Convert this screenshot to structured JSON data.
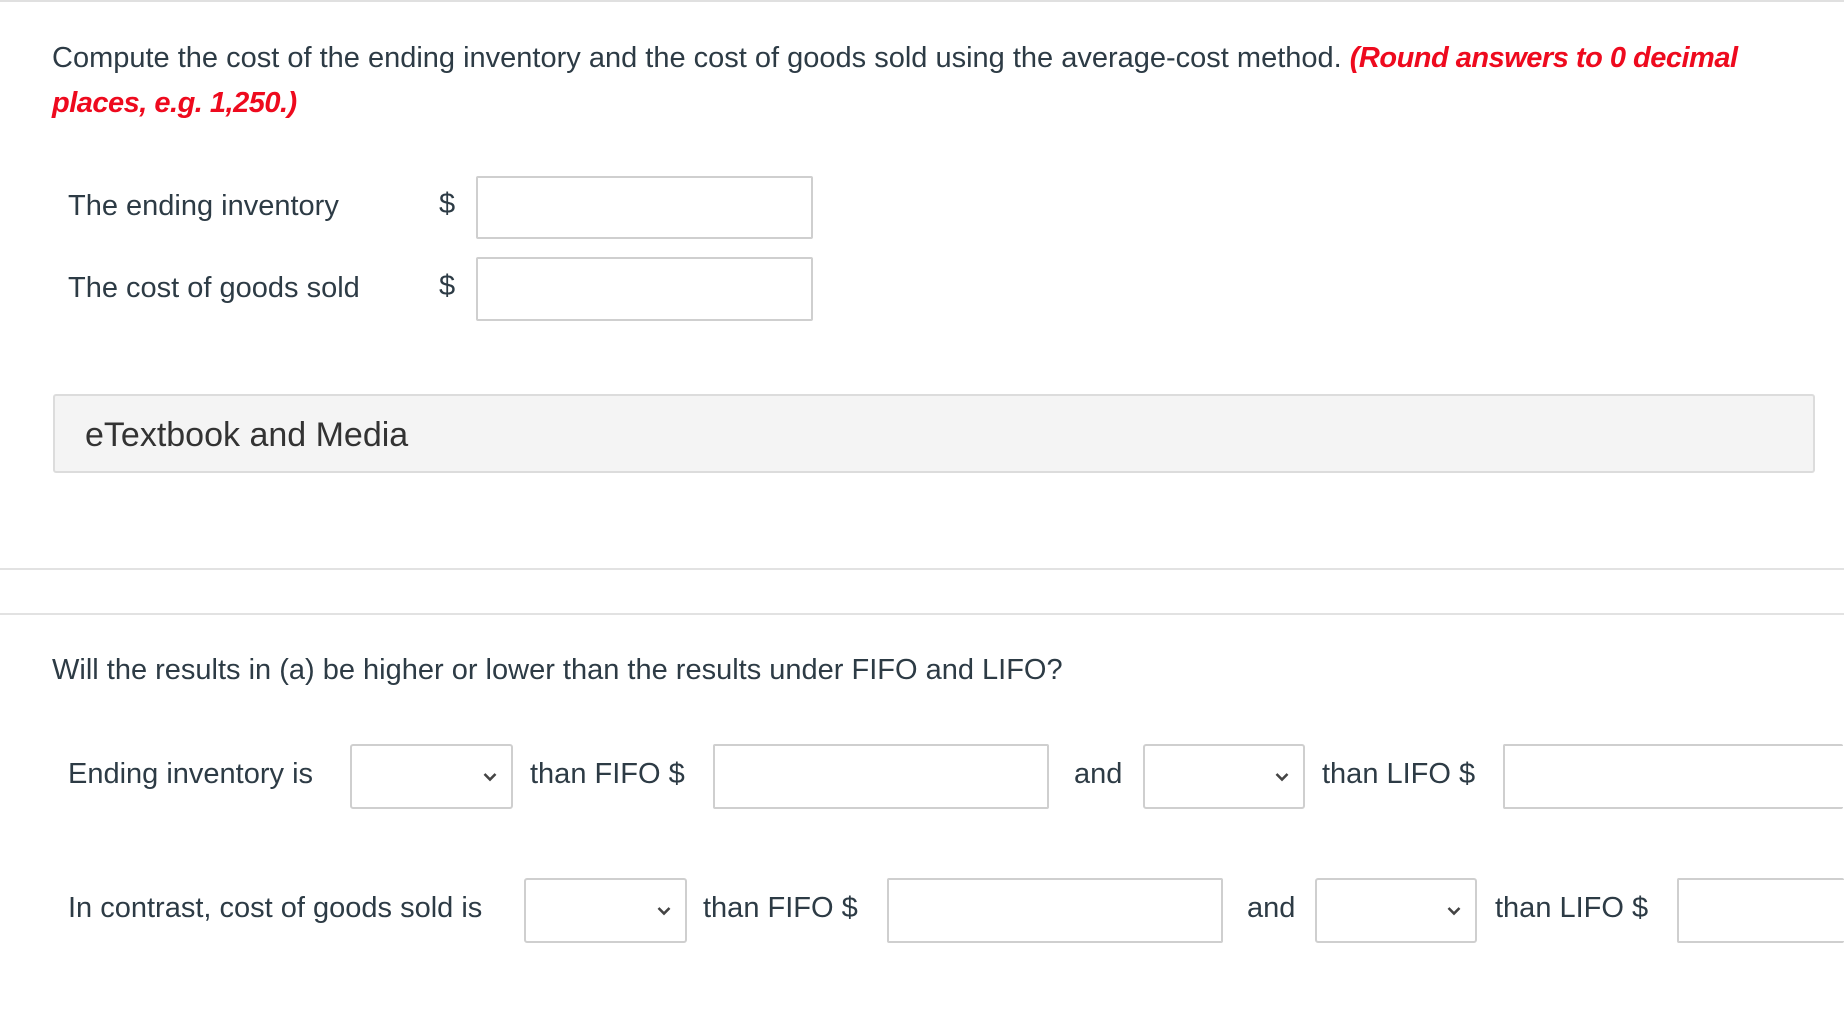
{
  "question": {
    "prompt": "Compute the cost of the ending inventory and the cost of goods sold using the average-cost method.",
    "hint": "(Round answers to 0 decimal places, e.g. 1,250.)"
  },
  "part_a": {
    "rows": [
      {
        "label": "The ending inventory",
        "currency": "$",
        "value": ""
      },
      {
        "label": "The cost of goods sold",
        "currency": "$",
        "value": ""
      }
    ]
  },
  "etextbook": {
    "label": "eTextbook and Media"
  },
  "part_b": {
    "question": "Will the results in (a) be higher or lower than the results under FIFO and LIFO?",
    "row1": {
      "label": "Ending inventory is",
      "select1": "",
      "than_fifo": "than FIFO $",
      "fifo_value": "",
      "and": "and",
      "select2": "",
      "than_lifo": "than LIFO $",
      "lifo_value": ""
    },
    "row2": {
      "label": "In contrast, cost of goods sold is",
      "select1": "",
      "than_fifo": "than FIFO $",
      "fifo_value": "",
      "and": "and",
      "select2": "",
      "than_lifo": "than LIFO $",
      "lifo_value": ""
    }
  }
}
